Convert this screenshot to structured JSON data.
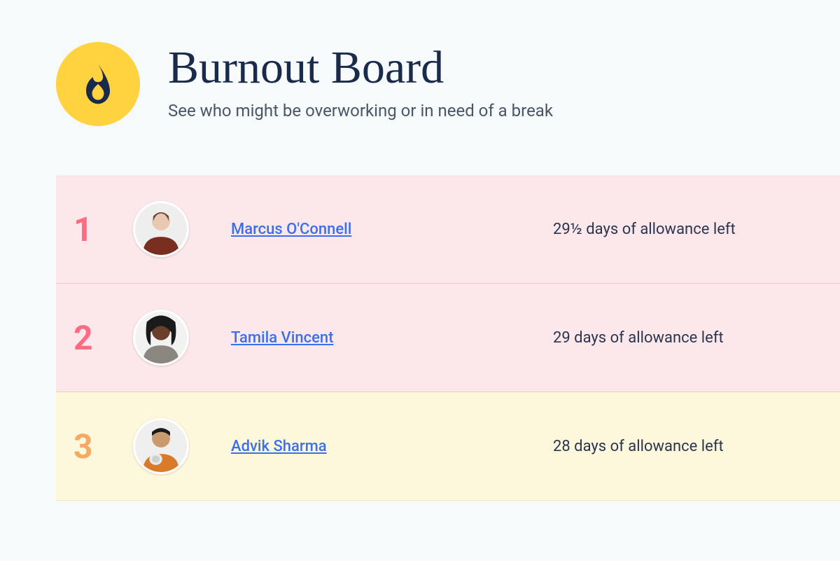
{
  "header": {
    "title": "Burnout Board",
    "subtitle": "See who might be overworking or in need of a break",
    "icon": "fire-icon"
  },
  "rows": [
    {
      "rank": "1",
      "name": "Marcus O'Connell",
      "allowance": "29½ days of allowance left",
      "style": "pink",
      "rank_style": "pink"
    },
    {
      "rank": "2",
      "name": "Tamila Vincent",
      "allowance": "29 days of allowance left",
      "style": "pink",
      "rank_style": "pink"
    },
    {
      "rank": "3",
      "name": "Advik Sharma",
      "allowance": "28 days of allowance left",
      "style": "cream",
      "rank_style": "orange"
    }
  ],
  "colors": {
    "accent_yellow": "#ffd23f",
    "title_navy": "#1a2a4a",
    "row_pink": "#fce8ea",
    "row_cream": "#fdf7dc",
    "name_blue": "#3a6ff0",
    "rank_pink": "#ff6b81",
    "rank_orange": "#f5a962"
  }
}
